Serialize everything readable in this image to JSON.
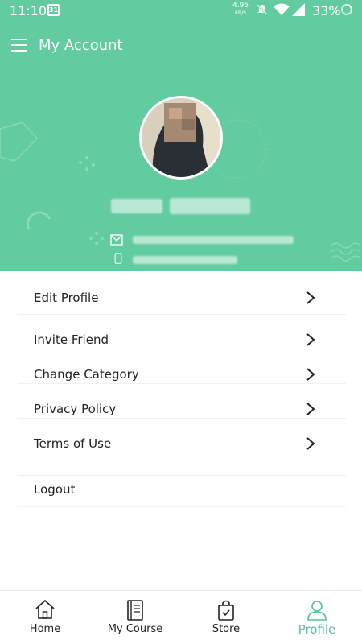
{
  "status_bar": {
    "time": "11:10",
    "calendar_day": "31",
    "net_speed": "4.95",
    "net_unit": "KB/S",
    "battery": "33%"
  },
  "header": {
    "title": "My Account"
  },
  "menu": {
    "items": [
      {
        "label": "Edit Profile"
      },
      {
        "label": "Invite Friend"
      },
      {
        "label": "Change Category"
      },
      {
        "label": "Privacy Policy"
      },
      {
        "label": "Terms of Use"
      }
    ],
    "logout_label": "Logout"
  },
  "bottom_nav": {
    "tabs": [
      {
        "label": "Home",
        "icon": "home-icon"
      },
      {
        "label": "My Course",
        "icon": "book-icon"
      },
      {
        "label": "Store",
        "icon": "shopping-bag-icon"
      },
      {
        "label": "Profile",
        "icon": "user-icon"
      }
    ],
    "active_tab": "Profile"
  },
  "colors": {
    "accent": "#63cba0",
    "active_tab": "#4fc39a"
  }
}
